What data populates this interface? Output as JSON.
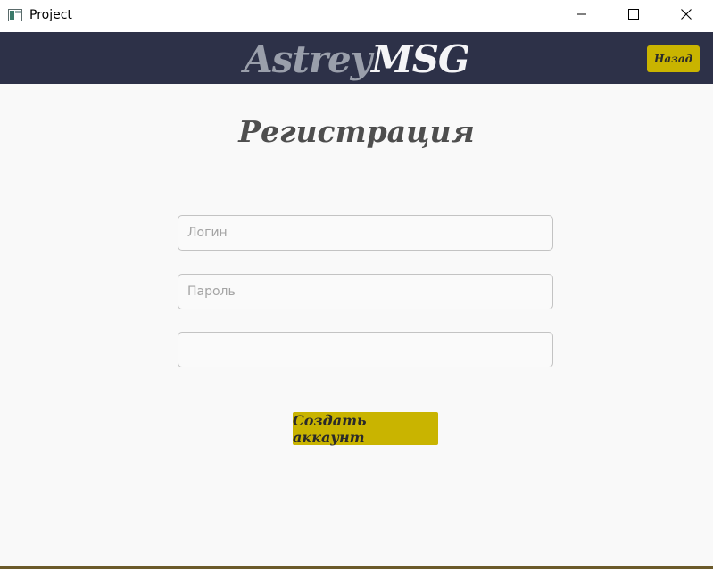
{
  "window": {
    "title": "Project",
    "icon": "app-window-icon",
    "controls": [
      "minimize-icon",
      "maximize-icon",
      "close-icon"
    ]
  },
  "header": {
    "logo_part1": "Astrey",
    "logo_part2": "MSG",
    "back_label": "Назад",
    "background": "#2d3148",
    "accent": "#c9b400"
  },
  "main": {
    "title": "Регистрация",
    "login": {
      "value": "",
      "placeholder": "Логин"
    },
    "password": {
      "value": "",
      "placeholder": "Пароль"
    },
    "confirm": {
      "value": "",
      "placeholder": ""
    },
    "create_label": "Создать аккаунт"
  }
}
